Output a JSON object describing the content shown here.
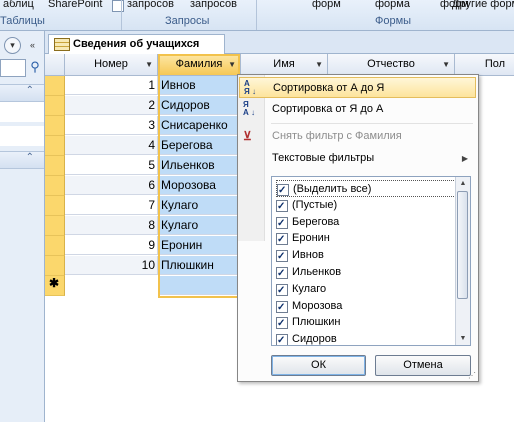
{
  "ribbon": {
    "top_texts": [
      "аблиц",
      "SharePoint",
      "запросов",
      "запросов",
      "форм",
      "форма",
      "форм",
      "Другие формы"
    ],
    "groups": [
      "Таблицы",
      "Запросы",
      "Формы"
    ]
  },
  "tab": {
    "title": "Сведения об учащихся"
  },
  "columns": [
    "Номер",
    "Фамилия",
    "Имя",
    "Отчество",
    "Пол"
  ],
  "rows": [
    {
      "num": "1",
      "fam": "Ивнов"
    },
    {
      "num": "2",
      "fam": "Сидоров"
    },
    {
      "num": "3",
      "fam": "Снисаренко"
    },
    {
      "num": "4",
      "fam": "Берегова"
    },
    {
      "num": "5",
      "fam": "Ильенков"
    },
    {
      "num": "6",
      "fam": "Морозова"
    },
    {
      "num": "7",
      "fam": "Кулаго"
    },
    {
      "num": "8",
      "fam": "Кулаго"
    },
    {
      "num": "9",
      "fam": "Еронин"
    },
    {
      "num": "10",
      "fam": "Плюшкин"
    }
  ],
  "menu": {
    "sort_asc": "Сортировка от А до Я",
    "sort_desc": "Сортировка от Я до А",
    "clear_filter": "Снять фильтр с Фамилия",
    "text_filters": "Текстовые фильтры",
    "values": [
      "(Выделить все)",
      "(Пустые)",
      "Берегова",
      "Еронин",
      "Ивнов",
      "Ильенков",
      "Кулаго",
      "Морозова",
      "Плюшкин",
      "Сидоров"
    ],
    "ok": "ОК",
    "cancel": "Отмена"
  }
}
